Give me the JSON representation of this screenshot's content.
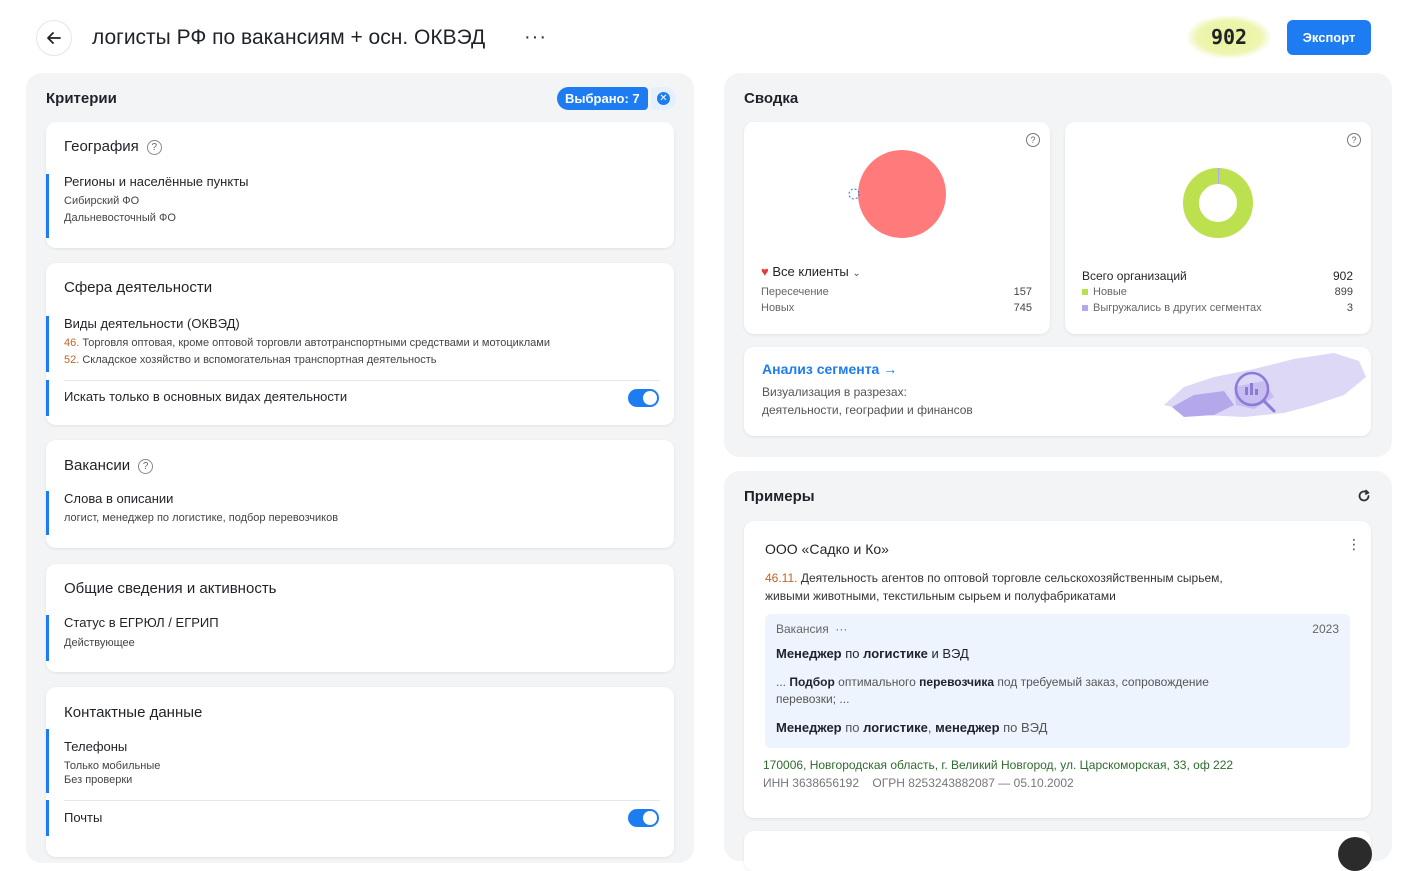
{
  "header": {
    "title": "логисты РФ по вакансиям + осн. ОКВЭД",
    "more": "···",
    "count": "902",
    "export_label": "Экспорт"
  },
  "criteria": {
    "title": "Критерии",
    "selected": "Выбрано: 7",
    "geography": {
      "title": "География",
      "regions_label": "Регионы и населённые пункты",
      "regions": [
        "Сибирский ФО",
        "Дальневосточный ФО"
      ]
    },
    "activity": {
      "title": "Сфера деятельности",
      "okved_label": "Виды деятельности (ОКВЭД)",
      "okved": [
        {
          "code": "46.",
          "text": " Торговля оптовая, кроме оптовой торговли автотранспортными средствами и мотоциклами"
        },
        {
          "code": "52.",
          "text": " Складское хозяйство и вспомогательная транспортная деятельность"
        }
      ],
      "main_only_label": "Искать только в основных видах деятельности",
      "main_only_on": true
    },
    "vacancies": {
      "title": "Вакансии",
      "words_label": "Слова в описании",
      "words": "логист, менеджер по логистике, подбор перевозчиков"
    },
    "general": {
      "title": "Общие сведения и активность",
      "status_label": "Статус в ЕГРЮЛ / ЕГРИП",
      "status": "Действующее"
    },
    "contacts": {
      "title": "Контактные данные",
      "phones_label": "Телефоны",
      "phones": [
        "Только мобильные",
        "Без проверки"
      ],
      "emails_label": "Почты",
      "emails_on": true
    }
  },
  "summary": {
    "title": "Сводка",
    "clients": {
      "label": "Все клиенты",
      "rows": [
        {
          "label": "Пересечение",
          "value": "157"
        },
        {
          "label": "Новых",
          "value": "745"
        }
      ],
      "color": "#ff7b7b"
    },
    "orgs": {
      "label": "Всего организаций",
      "total": "902",
      "rows": [
        {
          "label": "Новые",
          "value": "899",
          "color": "#b8e04a"
        },
        {
          "label": "Выгружались в других сегментах",
          "value": "3",
          "color": "#b9a6f0"
        }
      ]
    },
    "analysis": {
      "title": "Анализ сегмента",
      "arrow": "→",
      "desc_line1": "Визуализация в разрезах:",
      "desc_line2": "деятельности, географии и финансов"
    }
  },
  "examples": {
    "title": "Примеры",
    "company": "ООО «Садко и Ко»",
    "okved_code": "46.11.",
    "okved_text_1": " Деятельность агентов по оптовой торговле сельскохозяйственным сырьем,",
    "okved_text_2": "живыми животными, текстильным сырьем и полуфабрикатами",
    "vacancy_label": "Вакансия",
    "vacancy_more": "···",
    "vacancy_year": "2023",
    "vacancy_title_parts": [
      "Менеджер",
      " по ",
      "логистике",
      " и ВЭД"
    ],
    "vacancy_snippet_parts": [
      "... ",
      "Подбор",
      " оптимального ",
      "перевозчика",
      " под требуемый заказ, сопровождение"
    ],
    "vacancy_snippet_line2": "перевозки; ...",
    "vacancy_tags_parts": [
      "Менеджер",
      " по ",
      "логистике",
      ", ",
      "менеджер",
      " по ВЭД"
    ],
    "address": "170006, Новгородская область, г. Великий Новгород, ул. Царскоморская, 33, оф 222",
    "inn": "ИНН 3638656192",
    "ogrn": "ОГРН 8253243882087 — 05.10.2002"
  },
  "colors": {
    "accent": "#1d7cf2",
    "okved_code": "#c0642a",
    "address": "#2e6b2e"
  }
}
